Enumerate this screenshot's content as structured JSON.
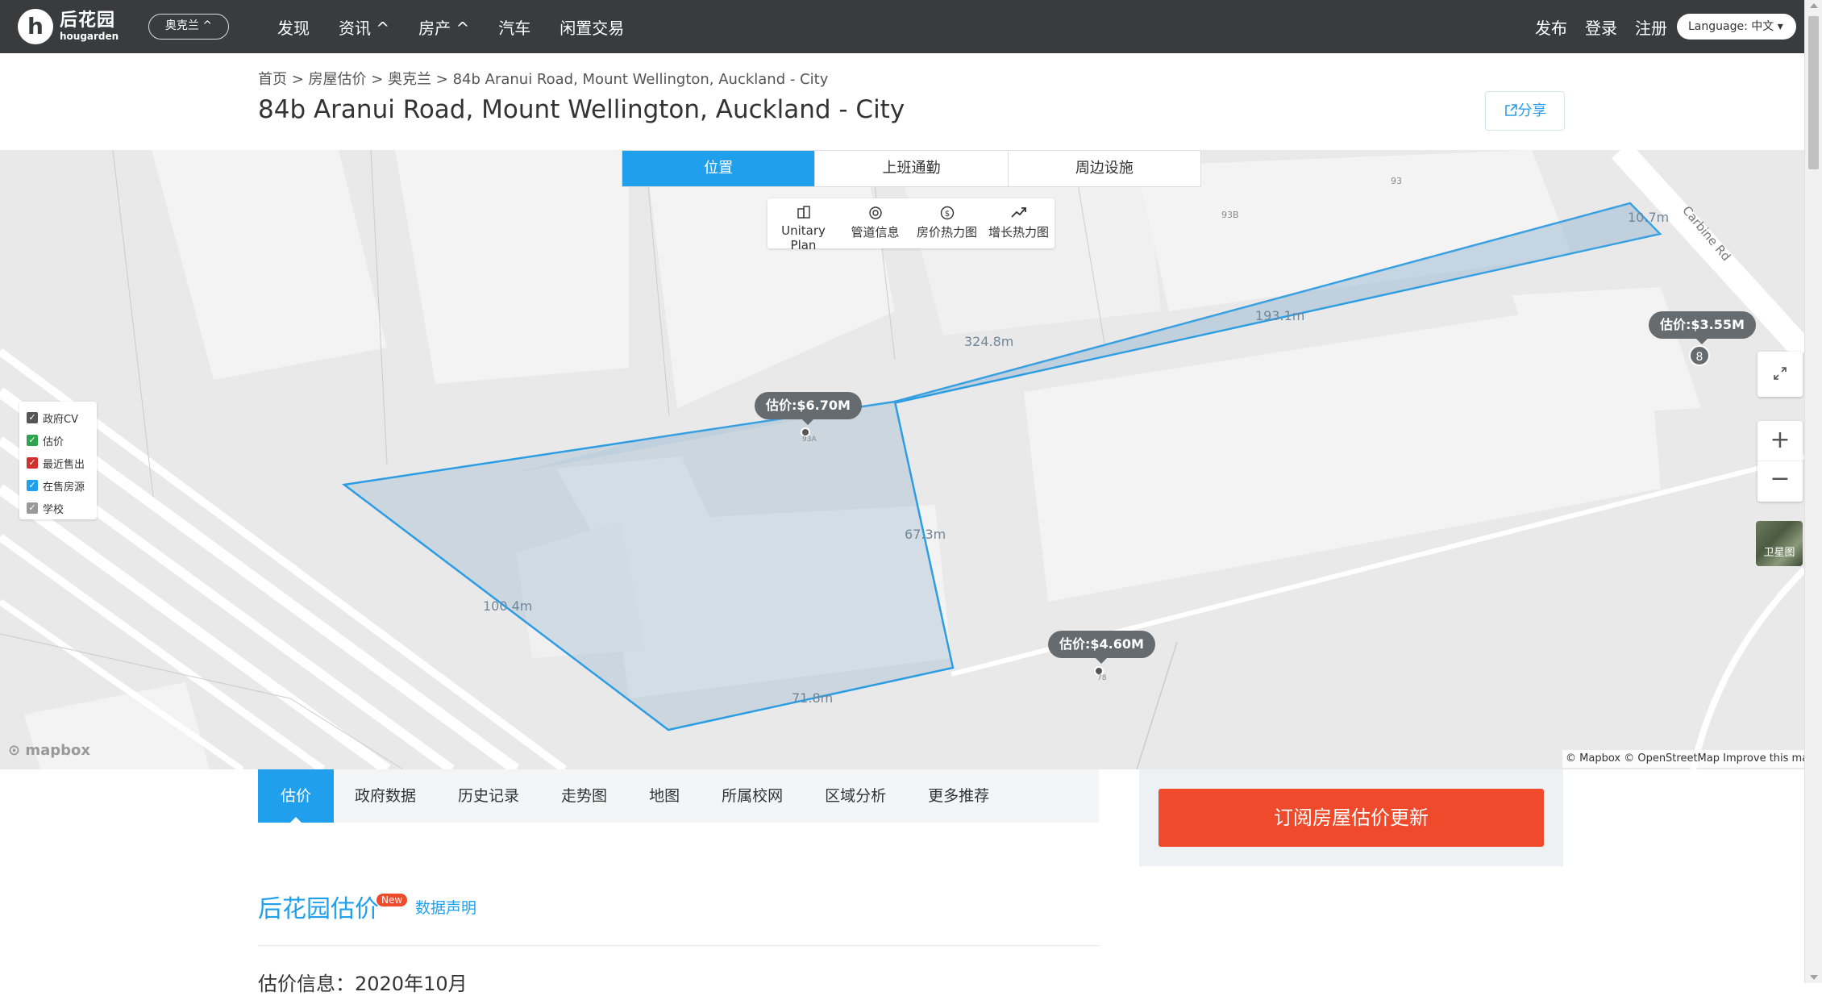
{
  "nav": {
    "logo_cn": "后花园",
    "logo_en": "hougarden",
    "logo_letter": "h",
    "region": "奥克兰 ^",
    "items": [
      "发现",
      "资讯 ^",
      "房产 ^",
      "汽车",
      "闲置交易"
    ],
    "publish": "发布",
    "login": "登录",
    "register": "注册",
    "language": "Language: 中文 ▾"
  },
  "breadcrumb": "首页 > 房屋估价 > 奥克兰 > 84b Aranui Road, Mount Wellington, Auckland - City",
  "title": "84b Aranui Road, Mount Wellington, Auckland - City",
  "share_label": "分享",
  "map": {
    "tabs": [
      {
        "label": "位置",
        "active": true
      },
      {
        "label": "上班通勤",
        "active": false
      },
      {
        "label": "周边设施",
        "active": false
      }
    ],
    "tools": [
      {
        "label": "Unitary Plan",
        "icon": "building-icon"
      },
      {
        "label": "管道信息",
        "icon": "pipe-icon"
      },
      {
        "label": "房价热力图",
        "icon": "dollar-icon"
      },
      {
        "label": "增长热力图",
        "icon": "trend-icon"
      }
    ],
    "legend": [
      {
        "label": "政府CV",
        "color": "#555555"
      },
      {
        "label": "估价",
        "color": "#2ea44f"
      },
      {
        "label": "最近售出",
        "color": "#d0312d"
      },
      {
        "label": "在售房源",
        "color": "#20a0ec"
      },
      {
        "label": "学校",
        "color": "#999999"
      }
    ],
    "price_tags": [
      {
        "label": "估价:$6.70M",
        "id": "93A"
      },
      {
        "label": "估价:$4.60M",
        "id": "78"
      },
      {
        "label": "估价:$3.55M",
        "count": "8"
      }
    ],
    "distances": [
      "324.8m",
      "193.1m",
      "10.7m",
      "67.3m",
      "100.4m",
      "71.8m"
    ],
    "lot_numbers": [
      "93",
      "93B"
    ],
    "street": "Carbine Rd",
    "satellite_label": "卫星图",
    "mapbox": "mapbox",
    "attribution": "© Mapbox © OpenStreetMap  Improve this map"
  },
  "sub_tabs": [
    {
      "label": "估价",
      "active": true
    },
    {
      "label": "政府数据",
      "active": false
    },
    {
      "label": "历史记录",
      "active": false
    },
    {
      "label": "走势图",
      "active": false
    },
    {
      "label": "地图",
      "active": false
    },
    {
      "label": "所属校网",
      "active": false
    },
    {
      "label": "区域分析",
      "active": false
    },
    {
      "label": "更多推荐",
      "active": false
    }
  ],
  "subscribe_label": "订阅房屋估价更新",
  "estimate": {
    "title": "后花园估价",
    "new_badge": "New",
    "data_link": "数据声明",
    "info": "估价信息：2020年10月"
  }
}
